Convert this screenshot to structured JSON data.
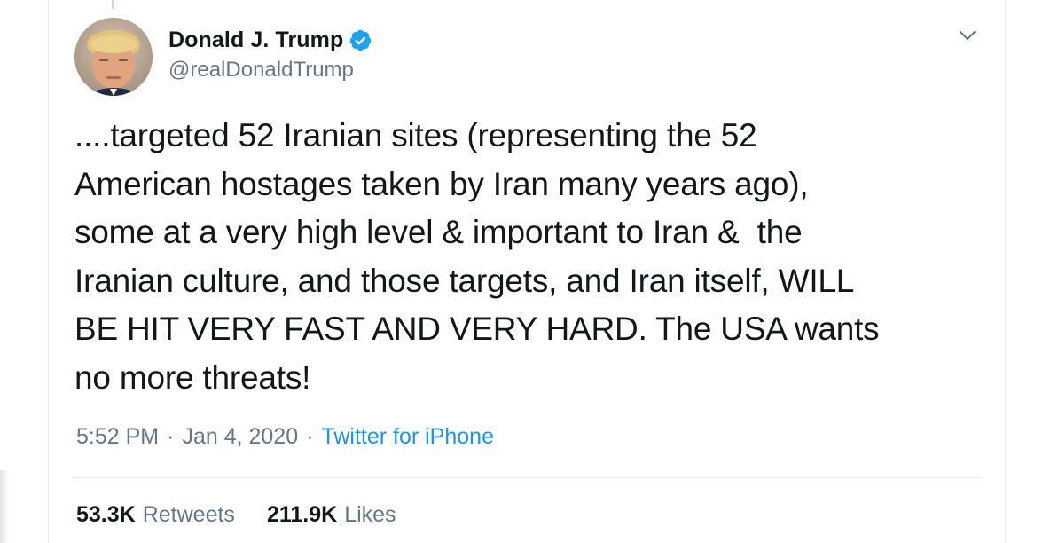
{
  "tweet": {
    "author": {
      "display_name": "Donald J. Trump",
      "handle": "@realDonaldTrump",
      "verified": true
    },
    "text": "....targeted 52 Iranian sites (representing the 52\nAmerican hostages taken by Iran many years ago),\nsome at a very high level & important to Iran &  the\nIranian culture, and those targets, and Iran itself, WILL\nBE HIT VERY FAST AND VERY HARD. The USA wants\nno more threats!",
    "time": "5:52 PM",
    "date": "Jan 4, 2020",
    "separator": "·",
    "source": "Twitter for iPhone",
    "stats": {
      "retweets_count": "53.3K",
      "retweets_label": "Retweets",
      "likes_count": "211.9K",
      "likes_label": "Likes"
    }
  },
  "colors": {
    "text_primary": "#14171a",
    "text_secondary": "#657786",
    "link": "#1b95e0",
    "verified_badge": "#1da1f2"
  },
  "icons": {
    "verified": "verified-badge-icon",
    "menu": "chevron-down-icon"
  }
}
